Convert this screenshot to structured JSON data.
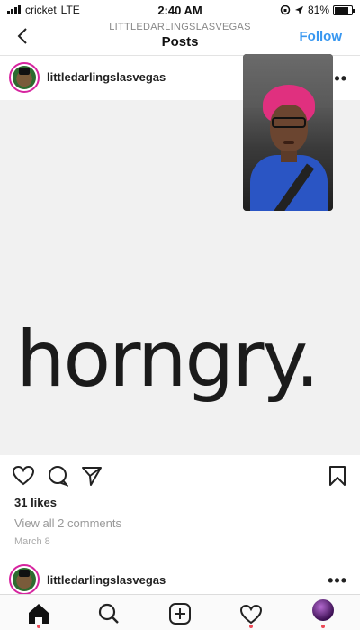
{
  "status_bar": {
    "carrier": "cricket",
    "network": "LTE",
    "time": "2:40 AM",
    "battery": "81%",
    "battery_level": 0.81
  },
  "header": {
    "subtitle": "LITTLEDARLINGSLASVEGAS",
    "title": "Posts",
    "follow_label": "Follow"
  },
  "post": {
    "username": "littledarlingslasvegas",
    "more": "•••",
    "headline": "horngry.",
    "likes": "31 likes",
    "comments_link": "View all 2 comments",
    "date": "March 8"
  },
  "next_post": {
    "username": "littledarlingslasvegas",
    "more": "•••"
  },
  "icons": {
    "back": "chevron-left-icon",
    "like": "heart-icon",
    "comment": "comment-icon",
    "share": "send-icon",
    "save": "bookmark-icon",
    "home": "home-icon",
    "search": "search-icon",
    "new_post": "plus-square-icon",
    "activity": "heart-icon",
    "profile": "avatar"
  },
  "colors": {
    "accent": "#3897f0",
    "notification_dot": "#ed4956"
  }
}
